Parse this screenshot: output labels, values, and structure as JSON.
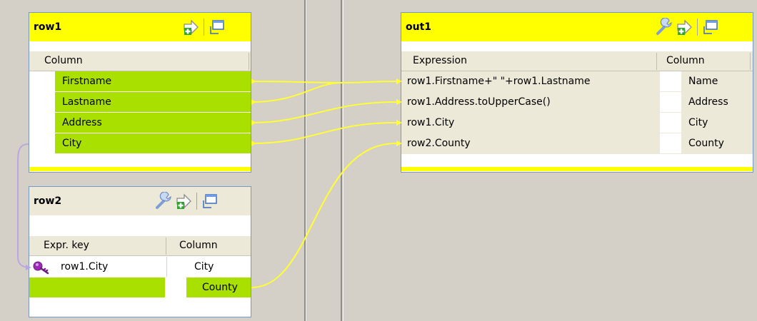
{
  "row1": {
    "title": "row1",
    "column_header": "Column",
    "columns": [
      "Firstname",
      "Lastname",
      "Address",
      "City"
    ]
  },
  "row2": {
    "title": "row2",
    "headers": {
      "expr_key": "Expr. key",
      "column": "Column"
    },
    "rows": [
      {
        "expr": "row1.City",
        "column": "City"
      },
      {
        "expr": "",
        "column": "County"
      }
    ]
  },
  "out1": {
    "title": "out1",
    "headers": {
      "expression": "Expression",
      "column": "Column"
    },
    "rows": [
      {
        "expression": "row1.Firstname+\" \"+row1.Lastname",
        "column": "Name"
      },
      {
        "expression": "row1.Address.toUpperCase()",
        "column": "Address"
      },
      {
        "expression": "row1.City",
        "column": "City"
      },
      {
        "expression": "row2.County",
        "column": "County"
      }
    ]
  },
  "colors": {
    "header_yellow": "#ffff00",
    "row_green": "#a9e000",
    "link_yellow": "#ffff33",
    "join_purple": "#b9a8e0"
  },
  "icons": [
    "add-column-icon",
    "minimize-icon",
    "expression-filter-icon",
    "key-icon"
  ]
}
